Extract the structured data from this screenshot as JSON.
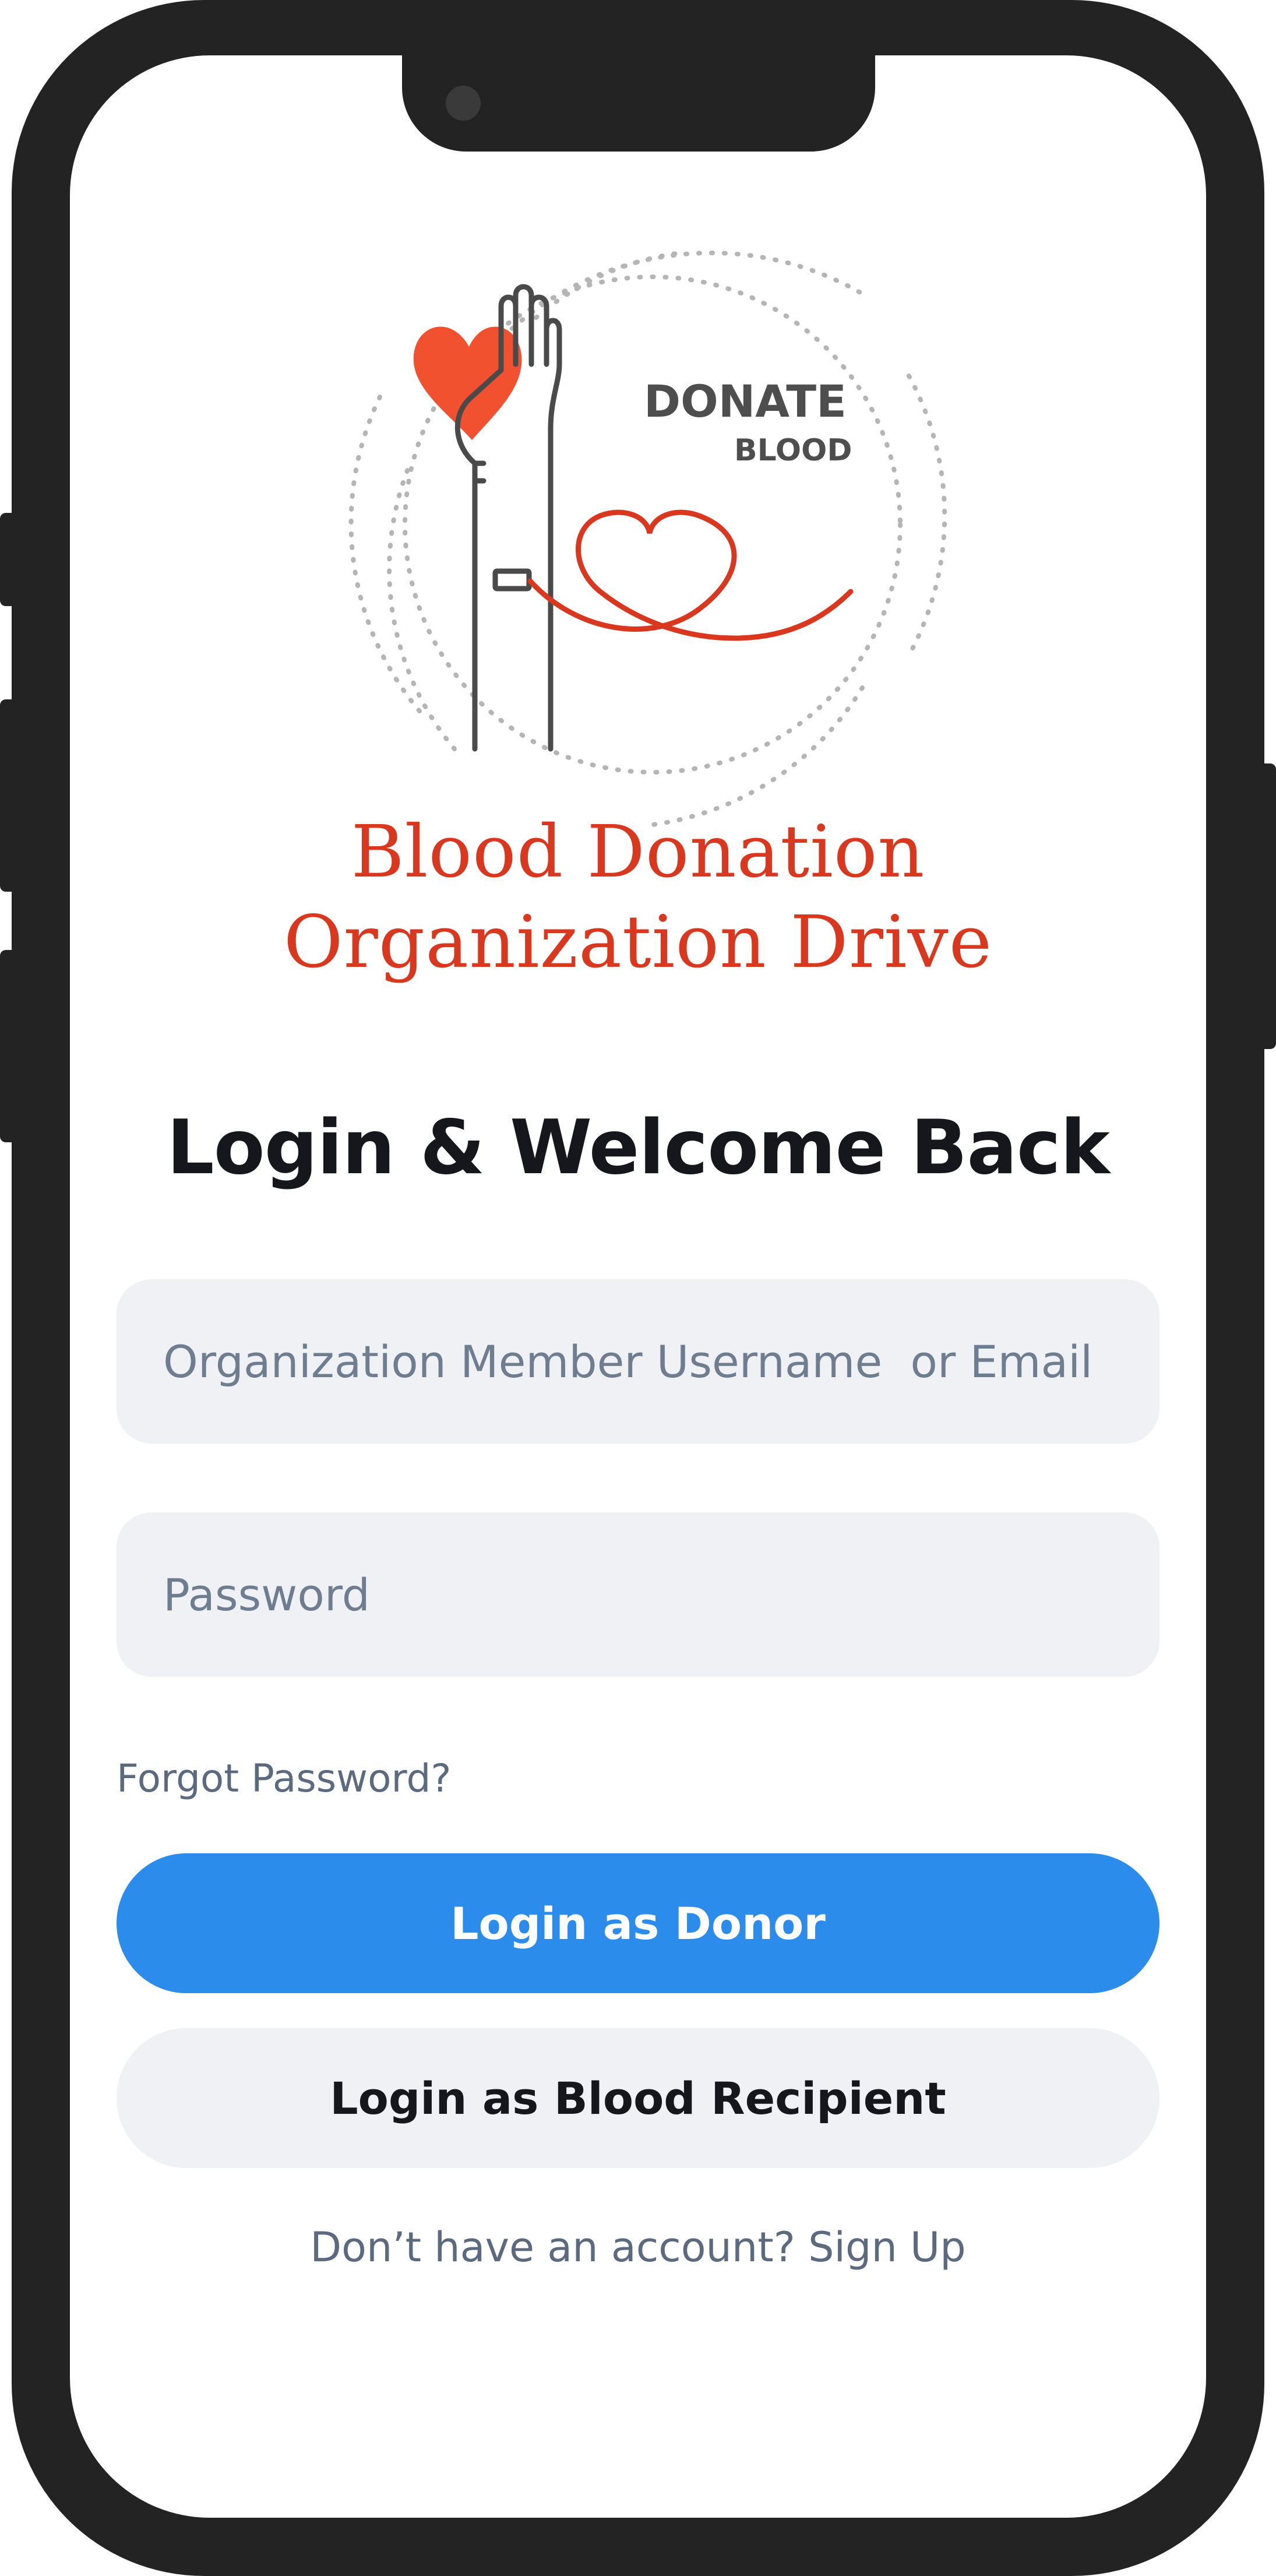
{
  "brand": {
    "logo_text_top": "DONATE",
    "logo_text_bottom": "BLOOD",
    "title_line1": "Blood Donation",
    "title_line2": "Organization Drive",
    "accent_color": "#d9381e"
  },
  "login": {
    "heading": "Login & Welcome Back",
    "username_placeholder": "Organization Member Username  or Email",
    "password_placeholder": "Password",
    "forgot_password": "Forgot Password?",
    "donor_button": "Login as Donor",
    "recipient_button": "Login as Blood Recipient",
    "signup_prompt": "Don’t have an account?",
    "signup_link": "Sign Up",
    "primary_color": "#2b8ceb"
  }
}
